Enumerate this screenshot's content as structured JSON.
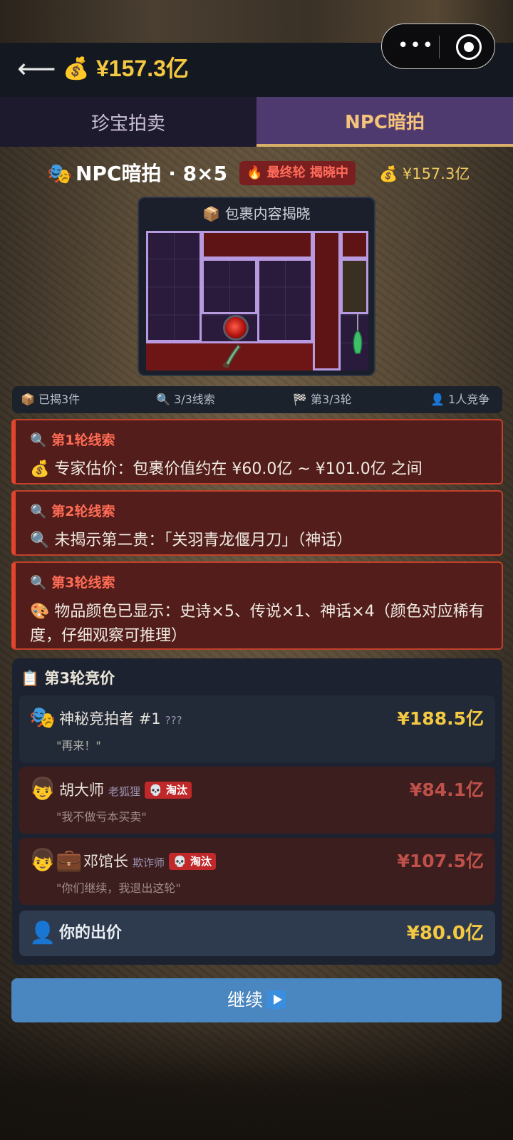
{
  "header": {
    "balance": "¥157.3亿",
    "icons": [
      "back-arrow-icon",
      "money-bag-icon",
      "more-icon",
      "target-icon"
    ]
  },
  "tabs": [
    {
      "label": "珍宝拍卖",
      "active": false
    },
    {
      "label": "NPC暗拍",
      "active": true
    }
  ],
  "title_row": {
    "title": "NPC暗拍 · 8×5",
    "status": "最终轮 揭晓中",
    "balance": "¥157.3亿"
  },
  "package": {
    "title": "包裹内容揭晓"
  },
  "stats": {
    "revealed": "已揭3件",
    "clues": "3/3线索",
    "round": "第3/3轮",
    "competitors": "1人竞争"
  },
  "clues": [
    {
      "title": "第1轮线索",
      "body": "专家估价：包裹价值约在 ¥60.0亿 ~ ¥101.0亿 之间",
      "icon": "money-bag-icon"
    },
    {
      "title": "第2轮线索",
      "body": "未揭示第二贵：「关羽青龙偃月刀」（神话）",
      "icon": "magnifier-icon"
    },
    {
      "title": "第3轮线索",
      "body": "物品颜色已显示：史诗×5、传说×1、神话×4（颜色对应稀有度，仔细观察可推理）",
      "icon": "palette-icon"
    }
  ],
  "bidding": {
    "title": "第3轮竞价",
    "bidders": [
      {
        "name": "神秘竞拍者 #1",
        "tag": "???",
        "amount": "¥188.5亿",
        "quote": "\"再来！\"",
        "eliminated": false,
        "badge": ""
      },
      {
        "name": "胡大师",
        "tag": "老狐狸",
        "amount": "¥84.1亿",
        "quote": "\"我不做亏本买卖\"",
        "eliminated": true,
        "badge": "淘汰"
      },
      {
        "name": "邓馆长",
        "tag": "欺诈师",
        "amount": "¥107.5亿",
        "quote": "\"你们继续，我退出这轮\"",
        "eliminated": true,
        "badge": "淘汰"
      }
    ],
    "you_label": "你的出价",
    "you_amount": "¥80.0亿"
  },
  "continue_label": "继续",
  "colors": {
    "gold": "#f5c842",
    "clue_red": "#ff6b55",
    "eliminated_amount": "#c0504a",
    "button_blue": "#4a86bf",
    "tab_active": "#4e3a6e"
  }
}
